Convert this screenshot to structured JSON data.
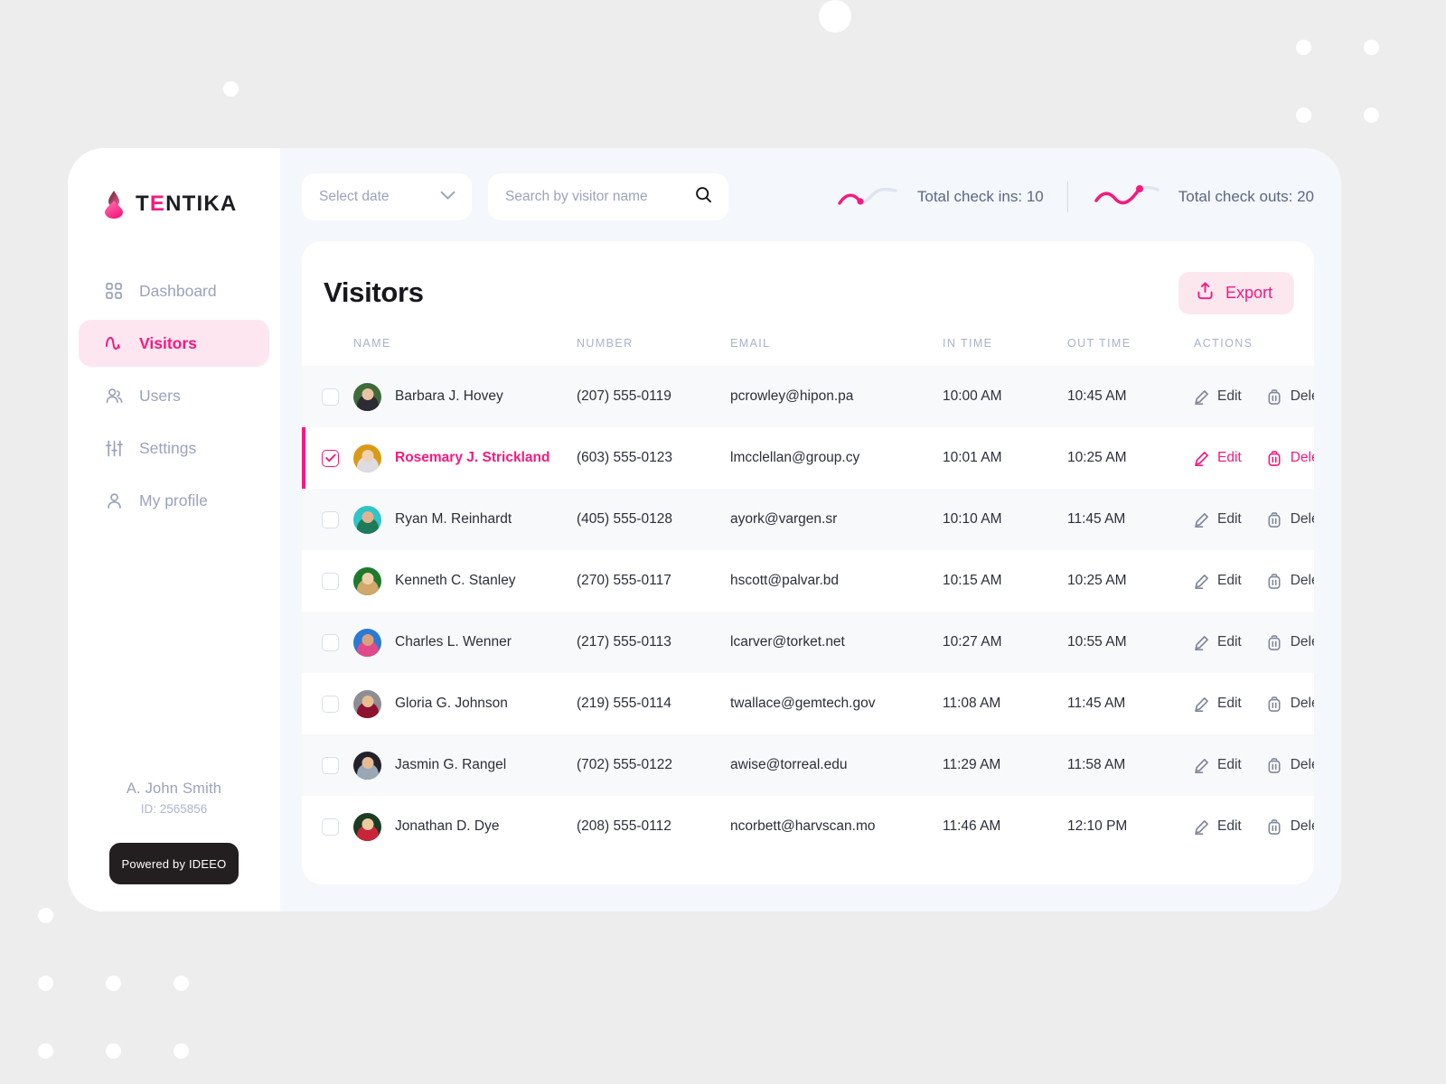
{
  "brand": {
    "logo_prefix": "T",
    "logo_accent": "E",
    "logo_suffix": "NTIKA",
    "logo_icon": "droplet-logo-icon"
  },
  "sidebar": {
    "items": [
      {
        "label": "Dashboard",
        "icon": "grid-icon",
        "active": false
      },
      {
        "label": "Visitors",
        "icon": "pulse-icon",
        "active": true
      },
      {
        "label": "Users",
        "icon": "users-icon",
        "active": false
      },
      {
        "label": "Settings",
        "icon": "sliders-icon",
        "active": false
      },
      {
        "label": "My profile",
        "icon": "person-icon",
        "active": false
      }
    ],
    "user_name": "A. John Smith",
    "user_id": "ID: 2565856",
    "powered_by": "Powered by IDEEO"
  },
  "topbar": {
    "date_select_label": "Select date",
    "date_select_icon": "chevron-down-icon",
    "search_placeholder": "Search by visitor name",
    "search_value": "",
    "search_icon": "search-icon",
    "stats": [
      {
        "label": "Total check ins: 10",
        "icon": "sparkline-up-icon"
      },
      {
        "label": "Total check outs: 20",
        "icon": "sparkline-wave-icon"
      }
    ]
  },
  "main": {
    "title": "Visitors",
    "export_label": "Export",
    "export_icon": "upload-icon",
    "columns": [
      "NAME",
      "NUMBER",
      "EMAIL",
      "IN TIME",
      "OUT TIME",
      "ACTIONS"
    ],
    "row_actions": {
      "edit_label": "Edit",
      "edit_icon": "pencil-icon",
      "delete_label": "Delete",
      "delete_icon": "trash-icon"
    },
    "rows": [
      {
        "name": "Barbara J. Hovey",
        "number": "(207) 555-0119",
        "email": "pcrowley@hipon.pa",
        "in_time": "10:00 AM",
        "out_time": "10:45 AM",
        "selected": false,
        "avatar_bg": "#3f6b3a",
        "avatar_skin": "#e8c4a5",
        "avatar_cloth": "#2c2c34"
      },
      {
        "name": "Rosemary J. Strickland",
        "number": "(603) 555-0123",
        "email": "lmcclellan@group.cy",
        "in_time": "10:01 AM",
        "out_time": "10:25 AM",
        "selected": true,
        "avatar_bg": "#d99a18",
        "avatar_skin": "#f0d2b2",
        "avatar_cloth": "#dcdce2"
      },
      {
        "name": "Ryan M. Reinhardt",
        "number": "(405) 555-0128",
        "email": "ayork@vargen.sr",
        "in_time": "10:10 AM",
        "out_time": "11:45 AM",
        "selected": false,
        "avatar_bg": "#2fc4c8",
        "avatar_skin": "#e3b391",
        "avatar_cloth": "#1f7a5a"
      },
      {
        "name": "Kenneth C. Stanley",
        "number": "(270) 555-0117",
        "email": "hscott@palvar.bd",
        "in_time": "10:15 AM",
        "out_time": "10:25 AM",
        "selected": false,
        "avatar_bg": "#1d7a2f",
        "avatar_skin": "#f0cfa8",
        "avatar_cloth": "#cfa86a"
      },
      {
        "name": "Charles L. Wenner",
        "number": "(217) 555-0113",
        "email": "lcarver@torket.net",
        "in_time": "10:27 AM",
        "out_time": "10:55 AM",
        "selected": false,
        "avatar_bg": "#2a7ad4",
        "avatar_skin": "#d9a27c",
        "avatar_cloth": "#e04a8a"
      },
      {
        "name": "Gloria G. Johnson",
        "number": "(219) 555-0114",
        "email": "twallace@gemtech.gov",
        "in_time": "11:08 AM",
        "out_time": "11:45 AM",
        "selected": false,
        "avatar_bg": "#8d8d93",
        "avatar_skin": "#e8bb93",
        "avatar_cloth": "#8c1231"
      },
      {
        "name": "Jasmin G. Rangel",
        "number": "(702) 555-0122",
        "email": "awise@torreal.edu",
        "in_time": "11:29 AM",
        "out_time": "11:58 AM",
        "selected": false,
        "avatar_bg": "#22222a",
        "avatar_skin": "#e5ba95",
        "avatar_cloth": "#9aa7b6"
      },
      {
        "name": "Jonathan D. Dye",
        "number": "(208) 555-0112",
        "email": "ncorbett@harvscan.mo",
        "in_time": "11:46 AM",
        "out_time": "12:10 PM",
        "selected": false,
        "avatar_bg": "#1c3c22",
        "avatar_skin": "#eccb9f",
        "avatar_cloth": "#c9253a"
      }
    ]
  },
  "theme": {
    "accent": "#f6197f",
    "accent_soft": "#fde7ef",
    "page_bg": "#ededed",
    "content_bg": "#f4f7fc",
    "row_alt": "#f8f9fb",
    "muted": "#9aa3bd"
  }
}
